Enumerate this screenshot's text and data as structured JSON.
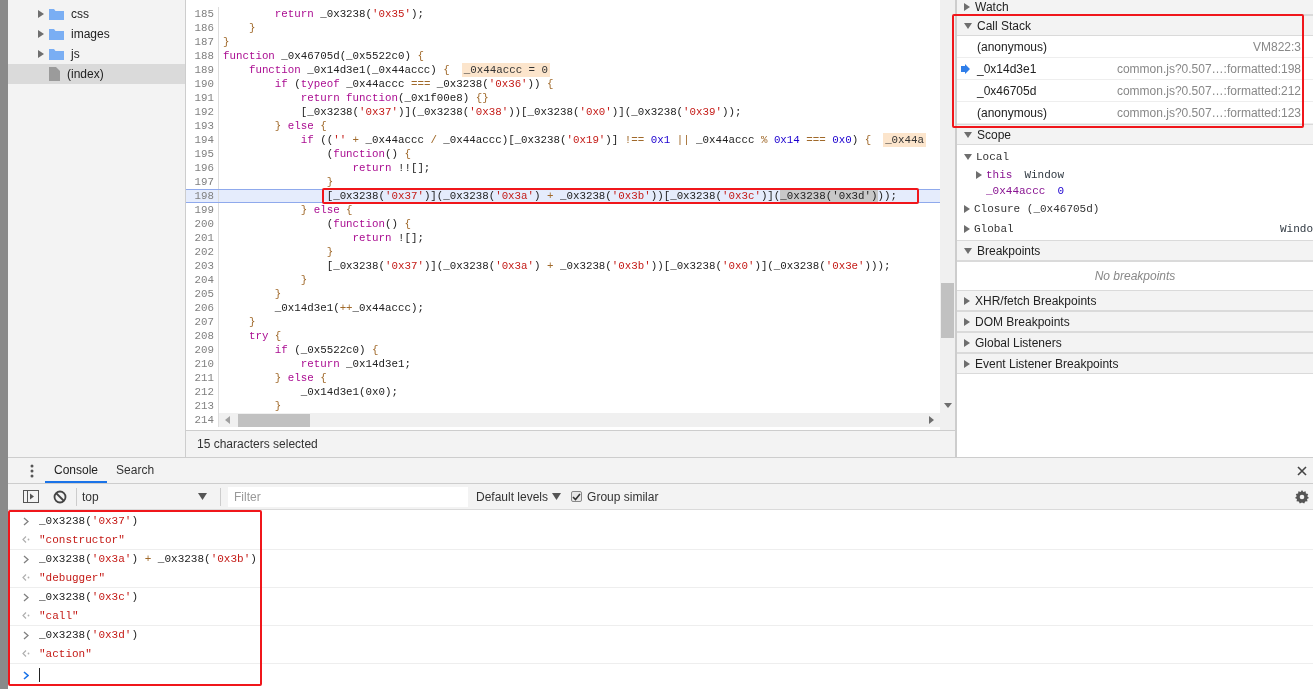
{
  "file_tree": {
    "items": [
      {
        "name": "css",
        "kind": "folder",
        "expanded": false,
        "selected": false
      },
      {
        "name": "images",
        "kind": "folder",
        "expanded": false,
        "selected": false
      },
      {
        "name": "js",
        "kind": "folder",
        "expanded": false,
        "selected": false
      },
      {
        "name": "(index)",
        "kind": "file",
        "selected": true
      }
    ]
  },
  "editor": {
    "lines": [
      {
        "number": "185",
        "current": false,
        "tokens": [
          {
            "kind": "keyword",
            "text": "        return"
          },
          {
            "kind": "plain",
            "text": " _0x3238("
          },
          {
            "kind": "string",
            "text": "'0x35'"
          },
          {
            "kind": "plain",
            "text": ");"
          }
        ]
      },
      {
        "number": "186",
        "current": false,
        "tokens": [
          {
            "kind": "operator",
            "text": "    }"
          }
        ]
      },
      {
        "number": "187",
        "current": false,
        "tokens": [
          {
            "kind": "operator",
            "text": "}"
          }
        ]
      },
      {
        "number": "188",
        "current": false,
        "tokens": [
          {
            "kind": "keyword",
            "text": "function"
          },
          {
            "kind": "plain",
            "text": " _0x46705d(_0x5522c0) "
          },
          {
            "kind": "operator",
            "text": "{"
          }
        ]
      },
      {
        "number": "189",
        "current": false,
        "tokens": [
          {
            "kind": "keyword",
            "text": "    function"
          },
          {
            "kind": "plain",
            "text": " _0x14d3e1(_0x44accc) "
          },
          {
            "kind": "operator",
            "text": "{"
          }
        ],
        "inline_value": "_0x44accc = 0"
      },
      {
        "number": "190",
        "current": false,
        "tokens": [
          {
            "kind": "keyword",
            "text": "        if"
          },
          {
            "kind": "plain",
            "text": " ("
          },
          {
            "kind": "keyword",
            "text": "typeof"
          },
          {
            "kind": "plain",
            "text": " _0x44accc "
          },
          {
            "kind": "operator",
            "text": "==="
          },
          {
            "kind": "plain",
            "text": " _0x3238("
          },
          {
            "kind": "string",
            "text": "'0x36'"
          },
          {
            "kind": "plain",
            "text": ")) "
          },
          {
            "kind": "operator",
            "text": "{"
          }
        ]
      },
      {
        "number": "191",
        "current": false,
        "tokens": [
          {
            "kind": "keyword",
            "text": "            return function"
          },
          {
            "kind": "plain",
            "text": "(_0x1f00e8) "
          },
          {
            "kind": "operator",
            "text": "{}"
          }
        ]
      },
      {
        "number": "192",
        "current": false,
        "tokens": [
          {
            "kind": "plain",
            "text": "            [_0x3238("
          },
          {
            "kind": "string",
            "text": "'0x37'"
          },
          {
            "kind": "plain",
            "text": ")](_0x3238("
          },
          {
            "kind": "string",
            "text": "'0x38'"
          },
          {
            "kind": "plain",
            "text": "))[_0x3238("
          },
          {
            "kind": "string",
            "text": "'0x0'"
          },
          {
            "kind": "plain",
            "text": ")](_0x3238("
          },
          {
            "kind": "string",
            "text": "'0x39'"
          },
          {
            "kind": "plain",
            "text": "));"
          }
        ]
      },
      {
        "number": "193",
        "current": false,
        "tokens": [
          {
            "kind": "operator",
            "text": "        } "
          },
          {
            "kind": "keyword",
            "text": "else"
          },
          {
            "kind": "operator",
            "text": " {"
          }
        ]
      },
      {
        "number": "194",
        "current": false,
        "tokens": [
          {
            "kind": "keyword",
            "text": "            if"
          },
          {
            "kind": "plain",
            "text": " (("
          },
          {
            "kind": "string",
            "text": "''"
          },
          {
            "kind": "operator",
            "text": " + "
          },
          {
            "kind": "plain",
            "text": "_0x44accc "
          },
          {
            "kind": "operator",
            "text": "/"
          },
          {
            "kind": "plain",
            "text": " _0x44accc)[_0x3238("
          },
          {
            "kind": "string",
            "text": "'0x19'"
          },
          {
            "kind": "plain",
            "text": ")] "
          },
          {
            "kind": "operator",
            "text": "!=="
          },
          {
            "kind": "number",
            "text": " 0x1 "
          },
          {
            "kind": "operator",
            "text": "||"
          },
          {
            "kind": "plain",
            "text": " _0x44accc "
          },
          {
            "kind": "operator",
            "text": "%"
          },
          {
            "kind": "number",
            "text": " 0x14 "
          },
          {
            "kind": "operator",
            "text": "==="
          },
          {
            "kind": "number",
            "text": " 0x0"
          },
          {
            "kind": "plain",
            "text": ") "
          },
          {
            "kind": "operator",
            "text": "{"
          }
        ],
        "inline_value": "_0x44a"
      },
      {
        "number": "195",
        "current": false,
        "tokens": [
          {
            "kind": "plain",
            "text": "                ("
          },
          {
            "kind": "keyword",
            "text": "function"
          },
          {
            "kind": "plain",
            "text": "() "
          },
          {
            "kind": "operator",
            "text": "{"
          }
        ]
      },
      {
        "number": "196",
        "current": false,
        "tokens": [
          {
            "kind": "keyword",
            "text": "                    return"
          },
          {
            "kind": "plain",
            "text": " !![];"
          }
        ]
      },
      {
        "number": "197",
        "current": false,
        "tokens": [
          {
            "kind": "operator",
            "text": "                }"
          }
        ]
      },
      {
        "number": "198",
        "current": true,
        "tokens": [
          {
            "kind": "plain",
            "text": "                [_0x3238("
          },
          {
            "kind": "string",
            "text": "'0x37'"
          },
          {
            "kind": "plain",
            "text": ")](_0x3238("
          },
          {
            "kind": "string",
            "text": "'0x3a'"
          },
          {
            "kind": "plain",
            "text": ") "
          },
          {
            "kind": "operator",
            "text": "+"
          },
          {
            "kind": "plain",
            "text": " _0x3238("
          },
          {
            "kind": "string",
            "text": "'0x3b'"
          },
          {
            "kind": "plain",
            "text": "))[_0x3238("
          },
          {
            "kind": "string",
            "text": "'0x3c'"
          },
          {
            "kind": "plain",
            "text": ")]("
          },
          {
            "kind": "selection",
            "text": "_0x3238('0x3d')"
          },
          {
            "kind": "plain",
            "text": "));"
          }
        ]
      },
      {
        "number": "199",
        "current": false,
        "tokens": [
          {
            "kind": "operator",
            "text": "            } "
          },
          {
            "kind": "keyword",
            "text": "else"
          },
          {
            "kind": "operator",
            "text": " {"
          }
        ]
      },
      {
        "number": "200",
        "current": false,
        "tokens": [
          {
            "kind": "plain",
            "text": "                ("
          },
          {
            "kind": "keyword",
            "text": "function"
          },
          {
            "kind": "plain",
            "text": "() "
          },
          {
            "kind": "operator",
            "text": "{"
          }
        ]
      },
      {
        "number": "201",
        "current": false,
        "tokens": [
          {
            "kind": "keyword",
            "text": "                    return"
          },
          {
            "kind": "plain",
            "text": " ![];"
          }
        ]
      },
      {
        "number": "202",
        "current": false,
        "tokens": [
          {
            "kind": "operator",
            "text": "                }"
          }
        ]
      },
      {
        "number": "203",
        "current": false,
        "tokens": [
          {
            "kind": "plain",
            "text": "                [_0x3238("
          },
          {
            "kind": "string",
            "text": "'0x37'"
          },
          {
            "kind": "plain",
            "text": ")](_0x3238("
          },
          {
            "kind": "string",
            "text": "'0x3a'"
          },
          {
            "kind": "plain",
            "text": ") "
          },
          {
            "kind": "operator",
            "text": "+"
          },
          {
            "kind": "plain",
            "text": " _0x3238("
          },
          {
            "kind": "string",
            "text": "'0x3b'"
          },
          {
            "kind": "plain",
            "text": "))[_0x3238("
          },
          {
            "kind": "string",
            "text": "'0x0'"
          },
          {
            "kind": "plain",
            "text": ")](_0x3238("
          },
          {
            "kind": "string",
            "text": "'0x3e'"
          },
          {
            "kind": "plain",
            "text": ")));"
          }
        ]
      },
      {
        "number": "204",
        "current": false,
        "tokens": [
          {
            "kind": "operator",
            "text": "            }"
          }
        ]
      },
      {
        "number": "205",
        "current": false,
        "tokens": [
          {
            "kind": "operator",
            "text": "        }"
          }
        ]
      },
      {
        "number": "206",
        "current": false,
        "tokens": [
          {
            "kind": "plain",
            "text": "        _0x14d3e1("
          },
          {
            "kind": "operator",
            "text": "++"
          },
          {
            "kind": "plain",
            "text": "_0x44accc);"
          }
        ]
      },
      {
        "number": "207",
        "current": false,
        "tokens": [
          {
            "kind": "operator",
            "text": "    }"
          }
        ]
      },
      {
        "number": "208",
        "current": false,
        "tokens": [
          {
            "kind": "keyword",
            "text": "    try"
          },
          {
            "kind": "operator",
            "text": " {"
          }
        ]
      },
      {
        "number": "209",
        "current": false,
        "tokens": [
          {
            "kind": "keyword",
            "text": "        if"
          },
          {
            "kind": "plain",
            "text": " (_0x5522c0) "
          },
          {
            "kind": "operator",
            "text": "{"
          }
        ]
      },
      {
        "number": "210",
        "current": false,
        "tokens": [
          {
            "kind": "keyword",
            "text": "            return"
          },
          {
            "kind": "plain",
            "text": " _0x14d3e1;"
          }
        ]
      },
      {
        "number": "211",
        "current": false,
        "tokens": [
          {
            "kind": "operator",
            "text": "        } "
          },
          {
            "kind": "keyword",
            "text": "else"
          },
          {
            "kind": "operator",
            "text": " {"
          }
        ]
      },
      {
        "number": "212",
        "current": false,
        "tokens": [
          {
            "kind": "plain",
            "text": "            _0x14d3e1(0x0);"
          }
        ]
      },
      {
        "number": "213",
        "current": false,
        "tokens": [
          {
            "kind": "operator",
            "text": "        }"
          }
        ]
      },
      {
        "number": "214",
        "current": false
      }
    ],
    "status": "15 characters selected"
  },
  "sidebar": {
    "sections": [
      {
        "title": "Watch",
        "expanded": false
      },
      {
        "title": "Call Stack",
        "expanded": true,
        "frames": [
          {
            "function": "(anonymous)",
            "location": "VM822:3",
            "current": false
          },
          {
            "function": "_0x14d3e1",
            "location": "common.js?0.507…:formatted:198",
            "current": true
          },
          {
            "function": "_0x46705d",
            "location": "common.js?0.507…:formatted:212",
            "current": false
          },
          {
            "function": "(anonymous)",
            "location": "common.js?0.507…:formatted:123",
            "current": false
          }
        ]
      },
      {
        "title": "Scope",
        "expanded": true,
        "scopes": [
          {
            "label": "Local",
            "expanded": true,
            "children": [
              {
                "name": "this",
                "value": "Window",
                "expanded": false
              },
              {
                "name": "_0x44accc",
                "value": "0"
              }
            ]
          },
          {
            "label": "Closure (_0x46705d)",
            "expanded": false
          },
          {
            "label": "Global",
            "value": "Windo",
            "expanded": false
          }
        ]
      },
      {
        "title": "Breakpoints",
        "expanded": true,
        "empty_text": "No breakpoints"
      },
      {
        "title": "XHR/fetch Breakpoints",
        "expanded": false
      },
      {
        "title": "DOM Breakpoints",
        "expanded": false
      },
      {
        "title": "Global Listeners",
        "expanded": false
      },
      {
        "title": "Event Listener Breakpoints",
        "expanded": false
      }
    ]
  },
  "console": {
    "tabs": [
      {
        "label": "Console",
        "selected": true
      },
      {
        "label": "Search",
        "selected": false
      }
    ],
    "toolbar": {
      "context": "top",
      "filter_placeholder": "Filter",
      "levels": "Default levels",
      "group_similar": {
        "label": "Group similar",
        "checked": true
      }
    },
    "messages": [
      {
        "kind": "input",
        "tokens": [
          {
            "kind": "plain",
            "text": "_0x3238("
          },
          {
            "kind": "string",
            "text": "'0x37'"
          },
          {
            "kind": "plain",
            "text": ")"
          }
        ]
      },
      {
        "kind": "result",
        "text": "\"constructor\""
      },
      {
        "kind": "input",
        "tokens": [
          {
            "kind": "plain",
            "text": "_0x3238("
          },
          {
            "kind": "string",
            "text": "'0x3a'"
          },
          {
            "kind": "plain",
            "text": ") "
          },
          {
            "kind": "operator",
            "text": "+"
          },
          {
            "kind": "plain",
            "text": " _0x3238("
          },
          {
            "kind": "string",
            "text": "'0x3b'"
          },
          {
            "kind": "plain",
            "text": ")"
          }
        ]
      },
      {
        "kind": "result",
        "text": "\"debugger\""
      },
      {
        "kind": "input",
        "tokens": [
          {
            "kind": "plain",
            "text": "_0x3238("
          },
          {
            "kind": "string",
            "text": "'0x3c'"
          },
          {
            "kind": "plain",
            "text": ")"
          }
        ]
      },
      {
        "kind": "result",
        "text": "\"call\""
      },
      {
        "kind": "input",
        "tokens": [
          {
            "kind": "plain",
            "text": "_0x3238("
          },
          {
            "kind": "string",
            "text": "'0x3d'"
          },
          {
            "kind": "plain",
            "text": ")"
          }
        ]
      },
      {
        "kind": "result",
        "text": "\"action\""
      }
    ]
  },
  "annotation_frames": [
    {
      "kind": "call_stack"
    },
    {
      "kind": "code"
    },
    {
      "kind": "console"
    }
  ]
}
